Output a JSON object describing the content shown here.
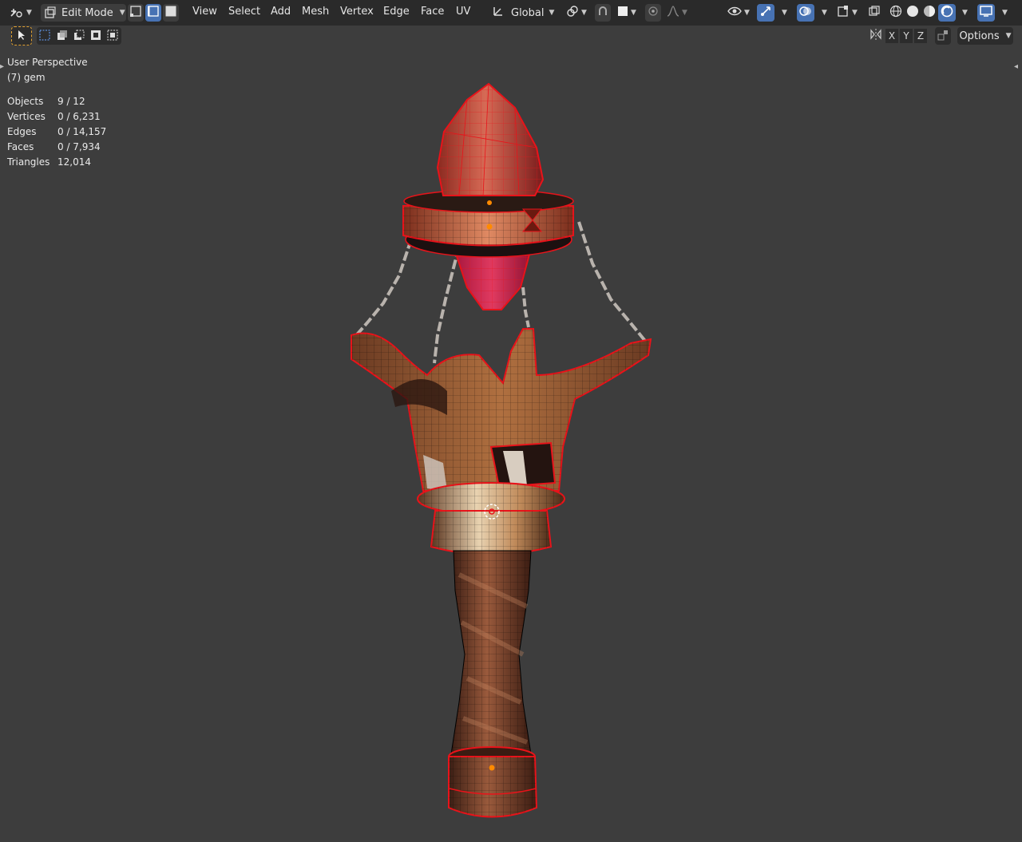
{
  "header": {
    "mode_label": "Edit Mode",
    "menus": [
      "View",
      "Select",
      "Add",
      "Mesh",
      "Vertex",
      "Edge",
      "Face",
      "UV"
    ],
    "transform_orientation": "Global"
  },
  "toolbar": {
    "options_label": "Options",
    "axes": [
      "X",
      "Y",
      "Z"
    ]
  },
  "overlay_stats": {
    "perspective": "User Perspective",
    "object_name": "(7) gem",
    "rows": [
      {
        "label": "Objects",
        "value": "9 / 12"
      },
      {
        "label": "Vertices",
        "value": "0 / 6,231"
      },
      {
        "label": "Edges",
        "value": "0 / 14,157"
      },
      {
        "label": "Faces",
        "value": "0 / 7,934"
      },
      {
        "label": "Triangles",
        "value": "12,014"
      }
    ]
  },
  "colors": {
    "header_bg": "#2a2a2a",
    "viewport_bg": "#3d3d3d",
    "active_blue": "#4772b3",
    "selection_red": "#e8131a"
  },
  "icons": {
    "editor_type": "editor-type-icon",
    "mode": "edit-mode-icon",
    "select_vertex": "vertex-select-icon",
    "select_edge": "edge-select-icon",
    "select_face": "face-select-icon",
    "transform": "transform-orientation-icon",
    "pivot": "pivot-point-icon",
    "snap": "snap-icon",
    "proportional": "proportional-edit-icon",
    "visibility": "visibility-icon",
    "gizmo": "gizmo-icon",
    "overlay": "overlay-icon",
    "xray": "xray-icon",
    "shading_wire": "wireframe-shading-icon",
    "shading_solid": "solid-shading-icon",
    "shading_material": "material-shading-icon",
    "shading_rendered": "rendered-shading-icon"
  }
}
